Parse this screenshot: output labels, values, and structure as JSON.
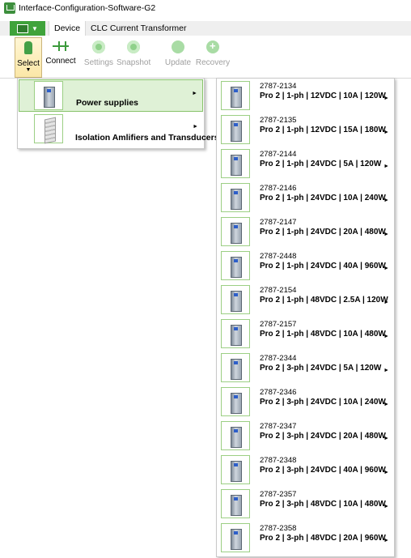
{
  "window": {
    "title": "Interface-Configuration-Software-G2"
  },
  "tabs": [
    {
      "label": "Device"
    },
    {
      "label": "CLC Current Transformer"
    }
  ],
  "ribbon": {
    "select": "Select",
    "connect": "Connect",
    "settings": "Settings",
    "snapshot": "Snapshot",
    "update": "Update",
    "recovery": "Recovery"
  },
  "menu_categories": [
    {
      "label": "Power supplies",
      "icon": "power-supply-icon"
    },
    {
      "label": "Isolation Amlifiers and Transducers",
      "icon": "isolation-amplifier-icon"
    }
  ],
  "products": [
    {
      "code": "2787-2134",
      "name": "Pro 2 | 1-ph | 12VDC | 10A | 120W"
    },
    {
      "code": "2787-2135",
      "name": "Pro 2 | 1-ph | 12VDC | 15A | 180W"
    },
    {
      "code": "2787-2144",
      "name": "Pro 2 | 1-ph | 24VDC | 5A | 120W"
    },
    {
      "code": "2787-2146",
      "name": "Pro 2 | 1-ph | 24VDC | 10A | 240W"
    },
    {
      "code": "2787-2147",
      "name": "Pro 2 | 1-ph | 24VDC | 20A | 480W"
    },
    {
      "code": "2787-2448",
      "name": "Pro 2 | 1-ph | 24VDC | 40A | 960W"
    },
    {
      "code": "2787-2154",
      "name": "Pro 2 | 1-ph | 48VDC | 2.5A | 120W"
    },
    {
      "code": "2787-2157",
      "name": "Pro 2 | 1-ph | 48VDC | 10A | 480W"
    },
    {
      "code": "2787-2344",
      "name": "Pro 2 | 3-ph | 24VDC | 5A | 120W"
    },
    {
      "code": "2787-2346",
      "name": "Pro 2 | 3-ph | 24VDC | 10A | 240W"
    },
    {
      "code": "2787-2347",
      "name": "Pro 2 | 3-ph | 24VDC | 20A | 480W"
    },
    {
      "code": "2787-2348",
      "name": "Pro 2 | 3-ph | 24VDC | 40A | 960W"
    },
    {
      "code": "2787-2357",
      "name": "Pro 2 | 3-ph | 48VDC | 10A | 480W"
    },
    {
      "code": "2787-2358",
      "name": "Pro 2 | 3-ph | 48VDC | 20A | 960W"
    }
  ],
  "colors": {
    "accent": "#3fa33b",
    "hover_fill": "#dff1d6",
    "hover_border": "#87c36a"
  }
}
